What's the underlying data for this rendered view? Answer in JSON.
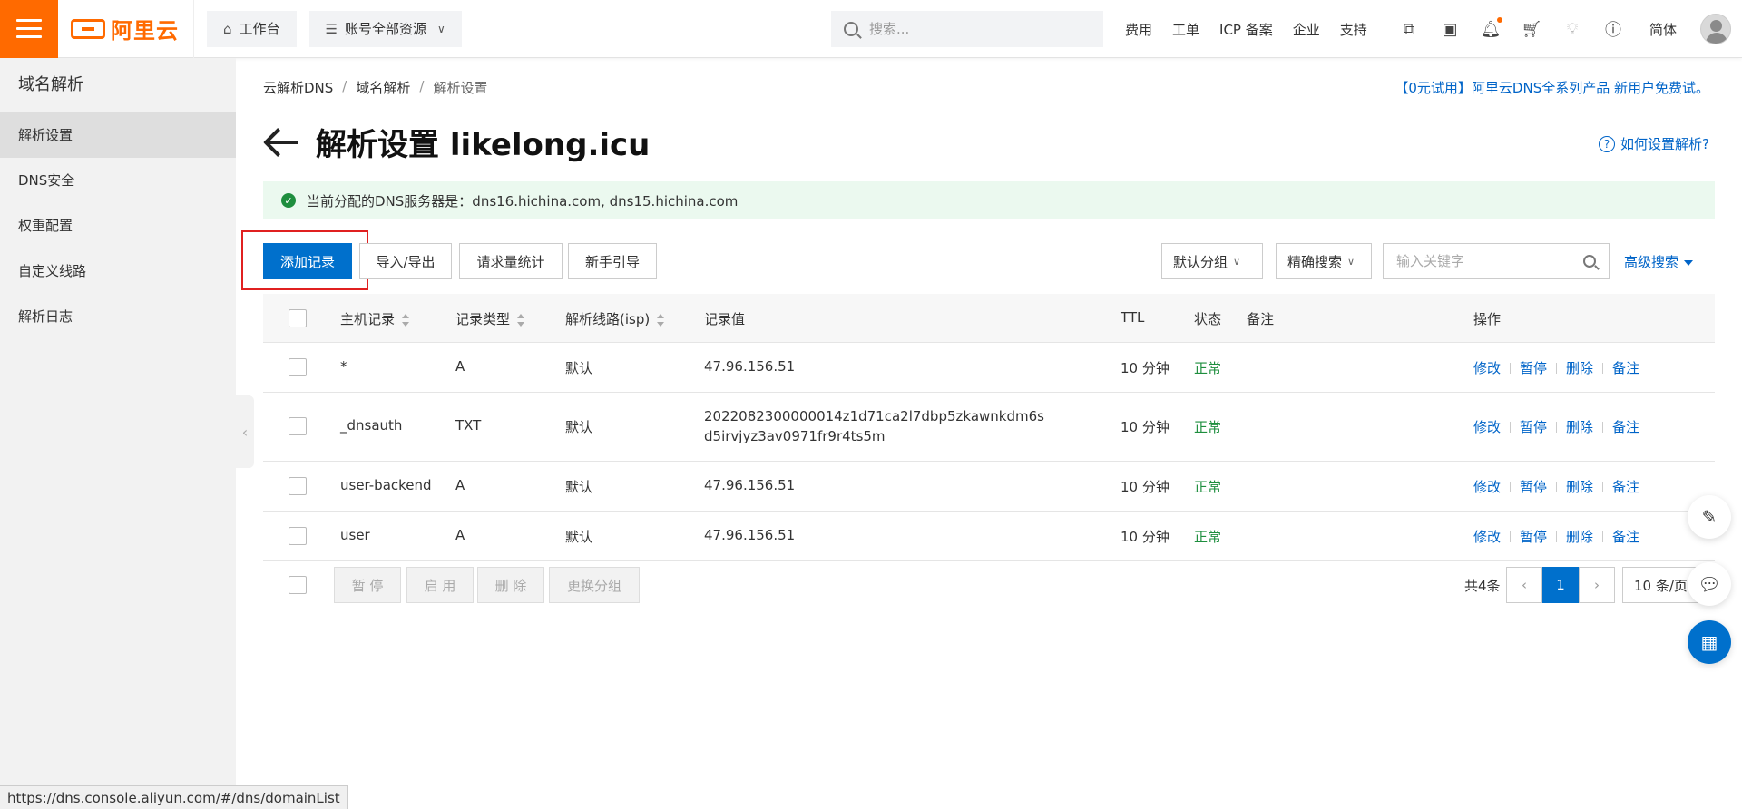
{
  "header": {
    "logo_text": "阿里云",
    "workbench": "工作台",
    "resources": "账号全部资源",
    "search_placeholder": "搜索...",
    "links": [
      "费用",
      "工单",
      "ICP 备案",
      "企业",
      "支持"
    ],
    "lang": "简体",
    "brand_color": "#ff6a00"
  },
  "sidebar": {
    "title": "域名解析",
    "items": [
      "解析设置",
      "DNS安全",
      "权重配置",
      "自定义线路",
      "解析日志"
    ]
  },
  "breadcrumb": [
    "云解析DNS",
    "域名解析",
    "解析设置"
  ],
  "promo": "【0元试用】阿里云DNS全系列产品 新用户免费试。",
  "page_title": "解析设置 likelong.icu",
  "help": "如何设置解析?",
  "alert": "当前分配的DNS服务器是：dns16.hichina.com, dns15.hichina.com",
  "toolbar": {
    "add": "添加记录",
    "import_export": "导入/导出",
    "stats": "请求量统计",
    "guide": "新手引导",
    "group": "默认分组",
    "search_mode": "精确搜索",
    "keyword_placeholder": "输入关键字",
    "advanced": "高级搜索"
  },
  "table": {
    "headers": [
      "主机记录",
      "记录类型",
      "解析线路(isp)",
      "记录值",
      "TTL",
      "状态",
      "备注",
      "操作"
    ],
    "rows": [
      {
        "host": "*",
        "type": "A",
        "line": "默认",
        "value": "47.96.156.51",
        "ttl": "10 分钟",
        "status": "正常"
      },
      {
        "host": "_dnsauth",
        "type": "TXT",
        "line": "默认",
        "value": "2022082300000014z1d71ca2l7dbp5zkawnkdm6sd5irvjyz3av0971fr9r4ts5m",
        "ttl": "10 分钟",
        "status": "正常"
      },
      {
        "host": "user-backend",
        "type": "A",
        "line": "默认",
        "value": "47.96.156.51",
        "ttl": "10 分钟",
        "status": "正常"
      },
      {
        "host": "user",
        "type": "A",
        "line": "默认",
        "value": "47.96.156.51",
        "ttl": "10 分钟",
        "status": "正常"
      }
    ],
    "ops": [
      "修改",
      "暂停",
      "删除",
      "备注"
    ]
  },
  "footer": {
    "batch": [
      "暂 停",
      "启 用",
      "删 除",
      "更换分组"
    ],
    "total": "共4条",
    "page": "1",
    "page_size": "10 条/页"
  },
  "status_url": "https://dns.console.aliyun.com/#/dns/domainList"
}
